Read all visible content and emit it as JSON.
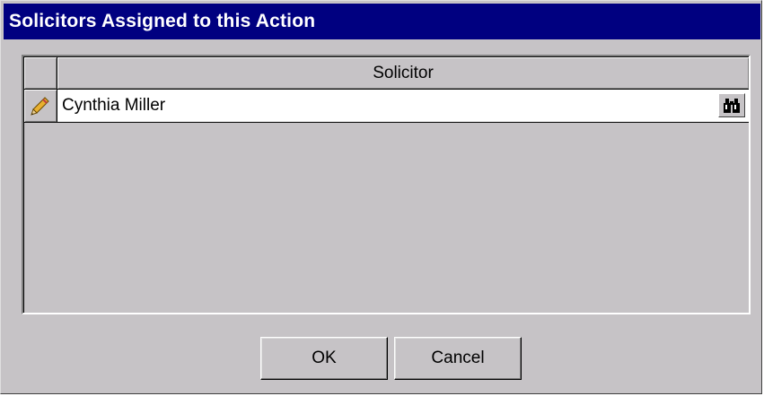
{
  "window": {
    "title": "Solicitors Assigned to this Action"
  },
  "grid": {
    "columns": [
      "Solicitor"
    ],
    "rows": [
      {
        "solicitor": "Cynthia Miller",
        "row_icon": "pencil-icon",
        "lookup_icon": "binoculars-icon"
      }
    ]
  },
  "buttons": {
    "ok_label": "OK",
    "cancel_label": "Cancel"
  },
  "colors": {
    "title_bar": "#000080",
    "dialog_face": "#c6c3c6",
    "row_background": "#ffffff"
  }
}
